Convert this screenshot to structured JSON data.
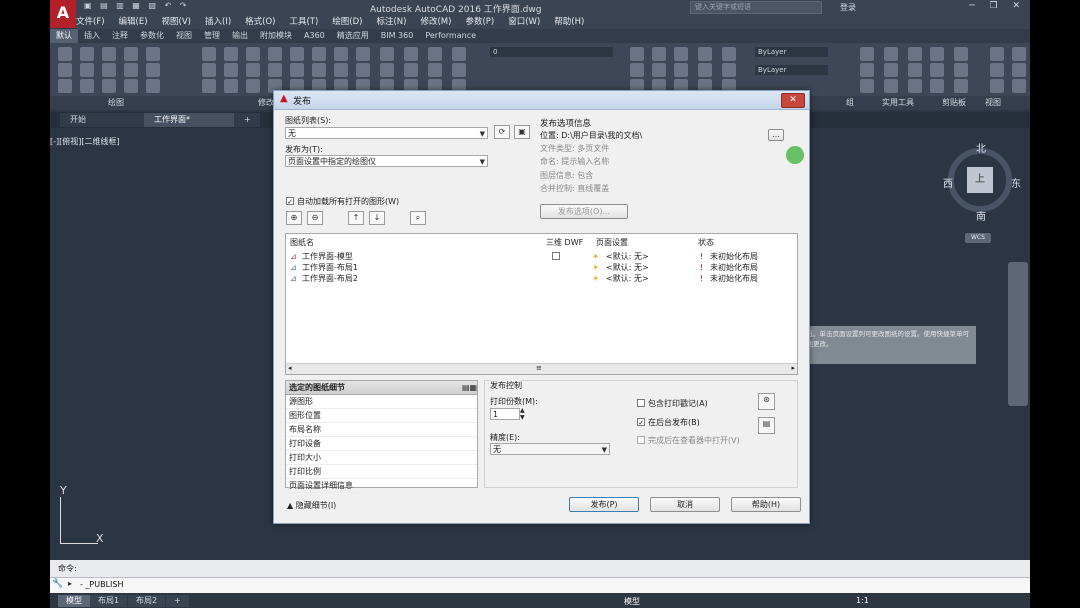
{
  "app": {
    "logo": "A",
    "title": "Autodesk AutoCAD 2016    工作界面.dwg",
    "search_placeholder": "键入关键字或短语",
    "login": "登录"
  },
  "menu": [
    "文件(F)",
    "编辑(E)",
    "视图(V)",
    "插入(I)",
    "格式(O)",
    "工具(T)",
    "绘图(D)",
    "标注(N)",
    "修改(M)",
    "参数(P)",
    "窗口(W)",
    "帮助(H)"
  ],
  "ribbon_tabs": [
    "默认",
    "插入",
    "注释",
    "参数化",
    "视图",
    "管理",
    "输出",
    "附加模块",
    "A360",
    "精选应用",
    "BIM 360",
    "Performance"
  ],
  "ribbon_panels": {
    "draw": "绘图",
    "modify": "修改",
    "group": "组",
    "utilities": "实用工具",
    "clipboard": "剪贴板",
    "view": "视图"
  },
  "ribbon_values": {
    "layer": "0",
    "color": "ByLayer",
    "linetype": "ByLayer"
  },
  "file_tabs": [
    "开始",
    "工作界面*"
  ],
  "viewport_label": "[-][俯视][二维线框]",
  "compass": {
    "n": "北",
    "s": "南",
    "e": "东",
    "w": "西",
    "top": "上",
    "wcs": "WCS"
  },
  "tooltip": "包含要发布到图纸集的图纸。单击页面设置列可更改图纸的设置。使用快捷菜单可添加图纸或对列表进行其他更改。",
  "ucs": {
    "x": "X",
    "y": "Y"
  },
  "command": {
    "history": "命令:",
    "current": "- _PUBLISH"
  },
  "layout_tabs": [
    "模型",
    "布局1",
    "布局2"
  ],
  "status": {
    "model": "模型",
    "scale": "1:1"
  },
  "dialog": {
    "title": "发布",
    "sheet_list_label": "图纸列表(S):",
    "sheet_list_value": "无",
    "publish_to_label": "发布为(T):",
    "publish_to_value": "页面设置中指定的绘图仪",
    "auto_load_label": "自动加载所有打开的图形(W)",
    "auto_load_checked": true,
    "options_info_title": "发布选项信息",
    "options_info": [
      "位置: D:\\用户目录\\我的文档\\",
      "文件类型: 多页文件",
      "命名: 提示输入名称",
      "图层信息: 包含",
      "合并控制: 直线覆盖"
    ],
    "options_btn": "发布选项(O)...",
    "columns": {
      "name": "图纸名",
      "dwf3d": "三维 DWF",
      "page_setup": "页面设置",
      "status": "状态"
    },
    "sheets": [
      {
        "name": "工作界面-模型",
        "page_setup": "<默认: 无>",
        "status": "未初始化布局",
        "has_3d": true
      },
      {
        "name": "工作界面-布局1",
        "page_setup": "<默认: 无>",
        "status": "未初始化布局",
        "has_3d": false
      },
      {
        "name": "工作界面-布局2",
        "page_setup": "<默认: 无>",
        "status": "未初始化布局",
        "has_3d": false
      }
    ],
    "details_title": "选定的图纸细节",
    "details": [
      "源图形",
      "图形位置",
      "布局名称",
      "打印设备",
      "打印大小",
      "打印比例",
      "页面设置详细信息"
    ],
    "control_title": "发布控制",
    "copies_label": "打印份数(M):",
    "copies_value": "1",
    "precision_label": "精度(E):",
    "precision_value": "无",
    "include_stamp": "包含打印戳记(A)",
    "include_stamp_checked": false,
    "background_publish": "在后台发布(B)",
    "background_publish_checked": true,
    "open_viewer": "完成后在查看器中打开(V)",
    "open_viewer_checked": false,
    "hide_details": "隐藏细节(I)",
    "publish_btn": "发布(P)",
    "cancel_btn": "取消",
    "help_btn": "帮助(H)"
  }
}
